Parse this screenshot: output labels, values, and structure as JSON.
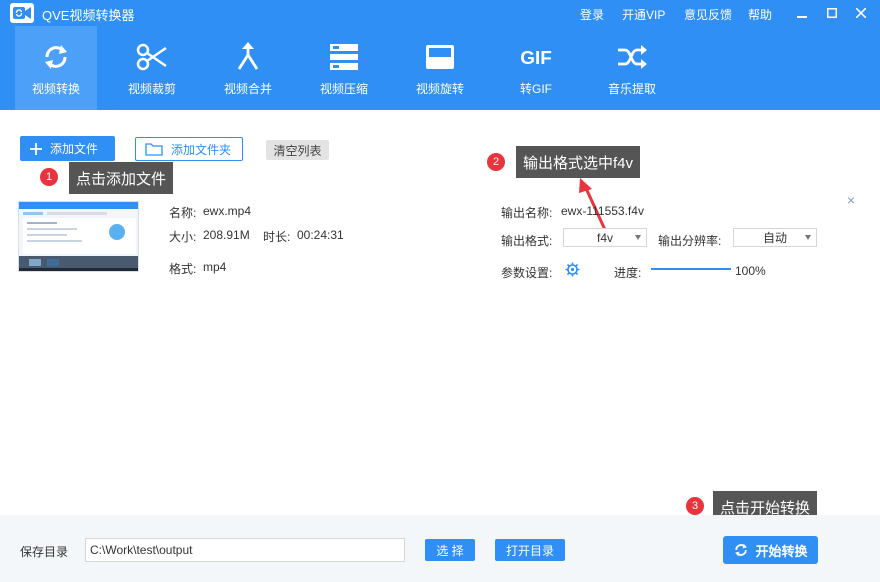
{
  "titlebar": {
    "title": "QVE视频转换器",
    "links": [
      "登录",
      "开通VIP",
      "意见反馈",
      "帮助"
    ]
  },
  "toolbar": {
    "items": [
      {
        "label": "视频转换",
        "icon": "refresh-icon",
        "active": true
      },
      {
        "label": "视频裁剪",
        "icon": "scissors-icon",
        "active": false
      },
      {
        "label": "视频合并",
        "icon": "merge-icon",
        "active": false
      },
      {
        "label": "视频压缩",
        "icon": "compress-icon",
        "active": false
      },
      {
        "label": "视频旋转",
        "icon": "rotate-icon",
        "active": false
      },
      {
        "label": "转GIF",
        "icon": "gif-icon",
        "active": false
      },
      {
        "label": "音乐提取",
        "icon": "shuffle-icon",
        "active": false
      }
    ]
  },
  "actions": {
    "add_file": "添加文件",
    "add_folder": "添加文件夹",
    "clear_list": "清空列表"
  },
  "annotations": [
    {
      "number": "1",
      "text": "点击添加文件"
    },
    {
      "number": "2",
      "text": "输出格式选中f4v"
    },
    {
      "number": "3",
      "text": "点击开始转换"
    }
  ],
  "file": {
    "name_label": "名称:",
    "name": "ewx.mp4",
    "size_label": "大小:",
    "size": "208.91M",
    "duration_label": "时长:",
    "duration": "00:24:31",
    "format_label": "格式:",
    "format": "mp4",
    "output_name_label": "输出名称:",
    "output_name": "ewx-111553.f4v",
    "output_format_label": "输出格式:",
    "output_format": "f4v",
    "resolution_label": "输出分辨率:",
    "resolution": "自动",
    "params_label": "参数设置:",
    "progress_label": "进度:",
    "progress_value": 1.0,
    "progress_text": "100%"
  },
  "bottom": {
    "save_label": "保存目录",
    "path": "C:\\Work\\test\\output",
    "choose": "选 择",
    "open_dir": "打开目录",
    "start": "开始转换"
  },
  "colors": {
    "primary": "#2f8ff5",
    "annotation_badge": "#e8343d",
    "callout_bg": "#555555"
  }
}
